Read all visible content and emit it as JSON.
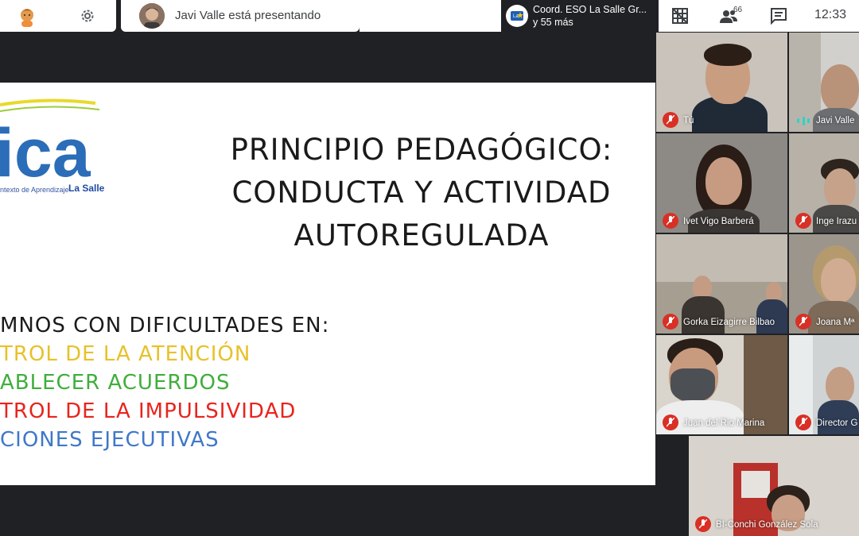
{
  "topbar": {
    "presenter_text": "Javi Valle está presentando",
    "meeting_title": "Coord. ESO La Salle Gr...",
    "meeting_sub": "y 55 más",
    "people_count": "66",
    "clock": "12:33"
  },
  "slide": {
    "logo_fragment": "ica",
    "logo_sub": "ntexto de Aprendizaje",
    "logo_brand": "La Salle",
    "title_lines": [
      "PRINCIPIO PEDAGÓGICO:",
      "CONDUCTA Y ACTIVIDAD",
      "AUTOREGULADA"
    ],
    "list_head": "MNOS CON DIFICULTADES EN:",
    "list_items": [
      "TROL DE LA ATENCIÓN",
      "ABLECER ACUERDOS",
      "TROL DE LA IMPULSIVIDAD",
      "CIONES EJECUTIVAS"
    ]
  },
  "participants": [
    {
      "name": "Tú",
      "muted": true
    },
    {
      "name": "Javi Valle",
      "muted": false
    },
    {
      "name": "Ivet Vigo Barberá",
      "muted": true
    },
    {
      "name": "Inge Irazu",
      "muted": true
    },
    {
      "name": "Gorka Eizagirre Bilbao",
      "muted": true
    },
    {
      "name": "Joana Mª",
      "muted": true
    },
    {
      "name": "Juan del Rio Marina",
      "muted": true
    },
    {
      "name": "Director G",
      "muted": true
    },
    {
      "name": "BI-Conchi González Sola",
      "muted": true
    }
  ],
  "colors": {
    "mic_muted": "#d93025",
    "speaking": "#2ed3c4",
    "list_yellow": "#e8c12a",
    "list_green": "#3fae3b",
    "list_red": "#e8241d",
    "list_blue": "#3f78c8"
  },
  "icons": [
    "emoji-icon",
    "gear-icon",
    "grid-icon",
    "people-icon",
    "chat-icon",
    "mic-off-icon"
  ]
}
